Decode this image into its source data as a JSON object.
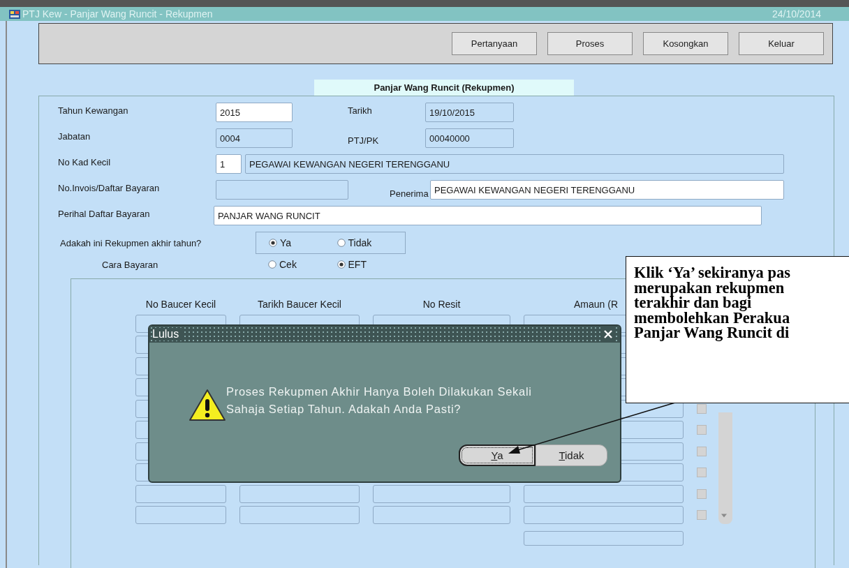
{
  "window": {
    "title": "PTJ Kew - Panjar Wang Runcit - Rekupmen",
    "date": "24/10/2014"
  },
  "toolbar": {
    "buttons": [
      "Pertanyaan",
      "Proses",
      "Kosongkan",
      "Keluar"
    ]
  },
  "section_title": "Panjar Wang Runcit (Rekupmen)",
  "form_rows": [
    {
      "items": [
        {
          "label": "Tahun Kewangan",
          "fields": [
            {
              "value": "2015",
              "editable": true
            }
          ]
        },
        {
          "label": "Tarikh",
          "fields": [
            {
              "value": "19/10/2015",
              "editable": false
            }
          ]
        }
      ]
    },
    {
      "items": [
        {
          "label": "Jabatan",
          "fields": [
            {
              "value": "0004",
              "editable": false
            }
          ]
        },
        {
          "label": "PTJ/PK",
          "fields": [
            {
              "value": "00040000",
              "editable": false
            }
          ]
        }
      ]
    },
    {
      "items": [
        {
          "label": "No Kad Kecil",
          "fields": [
            {
              "value": "1",
              "editable": true
            },
            {
              "value": "PEGAWAI KEWANGAN NEGERI TERENGGANU",
              "editable": false
            }
          ]
        }
      ]
    },
    {
      "items": [
        {
          "label": "No.Invois/Daftar Bayaran",
          "fields": [
            {
              "editable": false
            }
          ]
        },
        {
          "label": "Penerima",
          "fields": [
            {
              "value": "PEGAWAI KEWANGAN NEGERI TERENGGANU",
              "editable": true
            }
          ]
        }
      ]
    },
    {
      "items": [
        {
          "label": "Perihal Daftar Bayaran",
          "fields": [
            {
              "value": "PANJAR WANG RUNCIT",
              "editable": true
            }
          ]
        }
      ]
    }
  ],
  "radio_groups": [
    {
      "label": "Adakah ini Rekupmen akhir tahun?",
      "boxed": true,
      "options": [
        {
          "label": "Ya",
          "selected": true
        },
        {
          "label": "Tidak",
          "selected": false
        }
      ]
    },
    {
      "label": "Cara Bayaran",
      "boxed": false,
      "options": [
        {
          "label": "Cek",
          "selected": false
        },
        {
          "label": "EFT",
          "selected": true
        }
      ]
    }
  ],
  "table": {
    "columns": [
      "No Baucer Kecil",
      "Tarikh Baucer Kecil",
      "No Resit",
      "Amaun (R"
    ],
    "rows": [
      {
        "kind": "plain"
      },
      {
        "kind": "plain"
      },
      {
        "kind": "plain"
      },
      {
        "kind": "plain"
      },
      {
        "kind": "check",
        "checked": false
      },
      {
        "kind": "check",
        "checked": false
      },
      {
        "kind": "check",
        "checked": false
      },
      {
        "kind": "check",
        "checked": false
      },
      {
        "kind": "check",
        "checked": false
      },
      {
        "kind": "check",
        "checked": false
      }
    ]
  },
  "dialog": {
    "title": "Lulus",
    "message": "Proses Rekupmen Akhir Hanya Boleh Dilakukan Sekali Sahaja Setiap Tahun. Adakah Anda Pasti?",
    "buttons": [
      {
        "label": "Ya",
        "focused": true
      },
      {
        "label": "Tidak",
        "focused": false
      }
    ]
  },
  "callout": {
    "text": "Klik ‘Ya’ sekiranya pas\nmerupakan rekupmen\nterakhir dan bagi\nmembolehkan Perakua\nPanjar Wang Runcit di"
  }
}
